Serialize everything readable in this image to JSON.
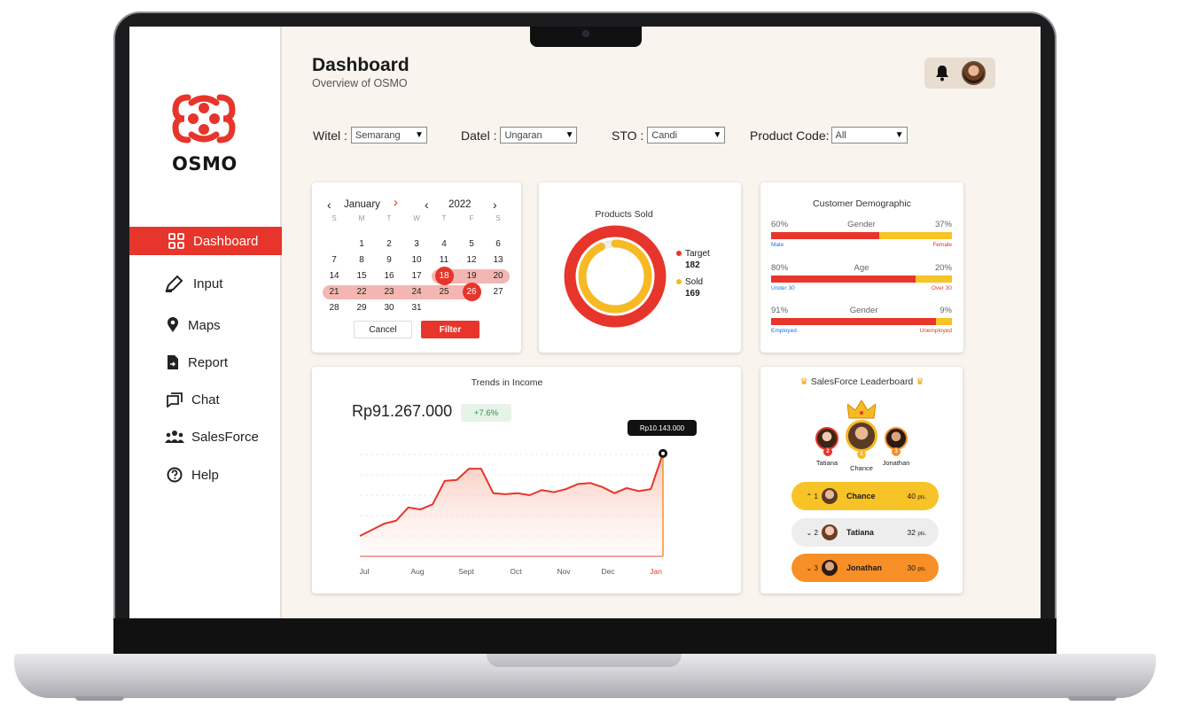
{
  "app": {
    "brand": "OSMO",
    "brand_color": "#e7352b"
  },
  "sidebar": {
    "items": [
      {
        "label": "Dashboard",
        "icon": "grid-icon",
        "active": true
      },
      {
        "label": "Input",
        "icon": "pen-icon"
      },
      {
        "label": "Maps",
        "icon": "map-pin-icon"
      },
      {
        "label": "Report",
        "icon": "document-icon"
      },
      {
        "label": "Chat",
        "icon": "chat-icon"
      },
      {
        "label": "SalesForce",
        "icon": "team-icon"
      },
      {
        "label": "Help",
        "icon": "help-icon"
      }
    ]
  },
  "header": {
    "title": "Dashboard",
    "subtitle": "Overview of OSMO"
  },
  "filters": [
    {
      "label": "Witel :",
      "value": "Semarang"
    },
    {
      "label": "Datel :",
      "value": "Ungaran"
    },
    {
      "label": "STO :",
      "value": "Candi"
    },
    {
      "label": "Product Code:",
      "value": "All"
    }
  ],
  "calendar": {
    "month": "January",
    "year": "2022",
    "weekdays": [
      "S",
      "M",
      "T",
      "W",
      "T",
      "F",
      "S"
    ],
    "weeks": [
      [
        "",
        "1",
        "2",
        "3",
        "4",
        "5",
        "6"
      ],
      [
        "7",
        "8",
        "9",
        "10",
        "11",
        "12",
        "13"
      ],
      [
        "14",
        "15",
        "16",
        "17",
        "18",
        "19",
        "20"
      ],
      [
        "21",
        "22",
        "23",
        "24",
        "25",
        "26",
        "27"
      ],
      [
        "28",
        "29",
        "30",
        "31",
        "",
        "",
        ""
      ]
    ],
    "range_start": "18",
    "range_end": "26",
    "cancel_label": "Cancel",
    "filter_label": "Filter"
  },
  "products_sold": {
    "title": "Products Sold",
    "legend": [
      {
        "label": "Target",
        "value": "182",
        "color": "#e7352b"
      },
      {
        "label": "Sold",
        "value": "169",
        "color": "#f7b924"
      }
    ]
  },
  "demographic": {
    "title": "Customer Demographic",
    "rows": [
      {
        "label": "Gender",
        "left_pct": "60%",
        "right_pct": "37%",
        "left_value": 60,
        "left_name": "Male",
        "right_name": "Female",
        "left_color": "#1a73e8",
        "right_color": "#e7352b"
      },
      {
        "label": "Age",
        "left_pct": "80%",
        "right_pct": "20%",
        "left_value": 80,
        "left_name": "Under 30",
        "right_name": "Over 30",
        "left_color": "#1a73e8",
        "right_color": "#e7352b"
      },
      {
        "label": "Gender",
        "left_pct": "91%",
        "right_pct": "9%",
        "left_value": 91,
        "left_name": "Employed",
        "right_name": "Unemployed",
        "left_color": "#1a73e8",
        "right_color": "#e7352b"
      }
    ]
  },
  "income": {
    "title": "Trends in Income",
    "total": "Rp91.267.000",
    "change": "+7.6%",
    "tooltip": "Rp10.143.000"
  },
  "chart_data": {
    "type": "area",
    "title": "Trends in Income",
    "x": [
      "Jul",
      "Aug",
      "Sept",
      "Oct",
      "Nov",
      "Dec",
      "Jan"
    ],
    "highlight": "Jan",
    "series": [
      {
        "values": [
          2.0,
          2.6,
          3.2,
          3.5,
          4.8,
          4.6,
          5.1,
          7.4,
          7.5,
          8.6,
          8.6,
          6.2,
          6.1,
          6.2,
          6.0,
          6.5,
          6.3,
          6.6,
          7.1,
          7.2,
          6.8,
          6.2,
          6.7,
          6.4,
          6.6,
          10.1
        ]
      }
    ],
    "ylim": [
      0,
      12
    ],
    "grid": true
  },
  "leaderboard": {
    "title": "SalesForce Leaderboard",
    "podium": [
      {
        "name": "Tatiana",
        "rank": "2"
      },
      {
        "name": "Chance",
        "rank": "1"
      },
      {
        "name": "Jonathan",
        "rank": "3"
      }
    ],
    "rows": [
      {
        "rank": "1",
        "arrow": "^",
        "name": "Chance",
        "points": "40",
        "unit": "pts.",
        "bg": "#f7c326"
      },
      {
        "rank": "2",
        "arrow": "v",
        "name": "Tatiana",
        "points": "32",
        "unit": "pts.",
        "bg": "#ededed"
      },
      {
        "rank": "3",
        "arrow": "v",
        "name": "Jonathan",
        "points": "30",
        "unit": "pts.",
        "bg": "#f78f26"
      }
    ]
  }
}
